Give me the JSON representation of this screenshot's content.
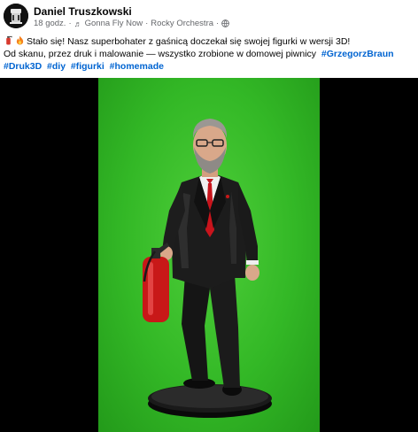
{
  "post": {
    "author": "Daniel Truszkowski",
    "time": "18 godz.",
    "separator": "·",
    "song": "Gonna Fly Now",
    "artist": "Rocky Orchestra",
    "icons": {
      "avatar": "avatar-photo",
      "music": "music-note-icon",
      "privacy": "globe-icon",
      "emoji1": "fire-extinguisher-emoji",
      "emoji2": "fire-emoji"
    }
  },
  "caption": {
    "line1": "Stało się! Nasz superbohater z gaśnicą doczekał się swojej figurki w wersji 3D!",
    "line2_text": "Od skanu, przez druk i malowanie — wszystko zrobione w domowej piwnicy",
    "tags": [
      "#GrzegorzBraun",
      "#Druk3D",
      "#diy",
      "#figurki",
      "#homemade"
    ]
  },
  "colors": {
    "tag": "#0064d1",
    "meta": "#65676b",
    "green_screen": "#33b826"
  }
}
